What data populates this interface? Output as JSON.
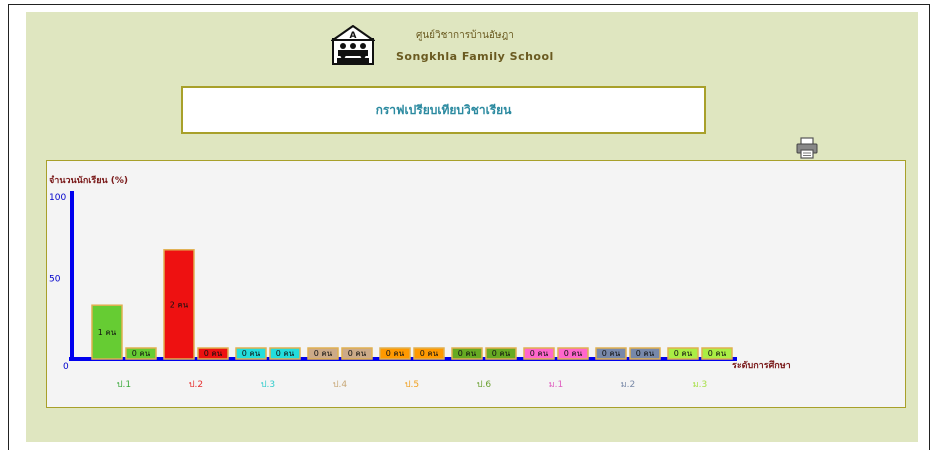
{
  "header": {
    "school_name_th": "ศูนย์วิชาการบ้านอัษฎา",
    "school_name_en": "Songkhla  Family  School",
    "logo_letter": "A"
  },
  "title_box": {
    "title": "กราฟเปรียบเทียบวิชาเรียน"
  },
  "toolbar": {
    "print_icon": "printer-icon"
  },
  "chart_data": {
    "type": "bar",
    "ylabel": "จำนวนนักเรียน (%)",
    "xlabel": "ระดับการศึกษา",
    "ylim": [
      0,
      100
    ],
    "yticks": [
      "0",
      "50",
      "100"
    ],
    "categories": [
      "ป.1",
      "ป.2",
      "ป.3",
      "ป.4",
      "ป.5",
      "ป.6",
      "ม.1",
      "ม.2",
      "ม.3"
    ],
    "category_colors": [
      "#3caa3c",
      "#e53030",
      "#33cccc",
      "#c8a878",
      "#f0a020",
      "#6aa030",
      "#e060c0",
      "#7a8aa8",
      "#a8e04a"
    ],
    "groups": [
      {
        "category": "ป.1",
        "bars": [
          {
            "value": 33,
            "label": "1 คน",
            "color": "#66cc33"
          },
          {
            "value": 0,
            "label": "0 คน",
            "color": "#66cc33"
          }
        ]
      },
      {
        "category": "ป.2",
        "bars": [
          {
            "value": 67,
            "label": "2 คน",
            "color": "#ee1111"
          },
          {
            "value": 0,
            "label": "0 คน",
            "color": "#ee1111"
          }
        ]
      },
      {
        "category": "ป.3",
        "bars": [
          {
            "value": 0,
            "label": "0 คน",
            "color": "#22dddd"
          },
          {
            "value": 0,
            "label": "0 คน",
            "color": "#22dddd"
          }
        ]
      },
      {
        "category": "ป.4",
        "bars": [
          {
            "value": 0,
            "label": "0 คน",
            "color": "#ccaa88"
          },
          {
            "value": 0,
            "label": "0 คน",
            "color": "#ccaa88"
          }
        ]
      },
      {
        "category": "ป.5",
        "bars": [
          {
            "value": 0,
            "label": "0 คน",
            "color": "#ff9900"
          },
          {
            "value": 0,
            "label": "0 คน",
            "color": "#ff9900"
          }
        ]
      },
      {
        "category": "ป.6",
        "bars": [
          {
            "value": 0,
            "label": "0 คน",
            "color": "#66aa22"
          },
          {
            "value": 0,
            "label": "0 คน",
            "color": "#66aa22"
          }
        ]
      },
      {
        "category": "ม.1",
        "bars": [
          {
            "value": 0,
            "label": "0 คน",
            "color": "#ff66cc"
          },
          {
            "value": 0,
            "label": "0 คน",
            "color": "#ff66cc"
          }
        ]
      },
      {
        "category": "ม.2",
        "bars": [
          {
            "value": 0,
            "label": "0 คน",
            "color": "#7788aa"
          },
          {
            "value": 0,
            "label": "0 คน",
            "color": "#7788aa"
          }
        ]
      },
      {
        "category": "ม.3",
        "bars": [
          {
            "value": 0,
            "label": "0 คน",
            "color": "#aaee44"
          },
          {
            "value": 0,
            "label": "0 คน",
            "color": "#aaee44"
          }
        ]
      }
    ]
  }
}
